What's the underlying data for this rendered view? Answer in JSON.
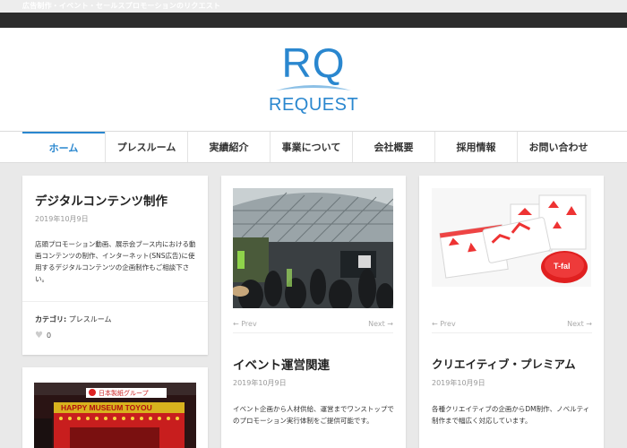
{
  "site": {
    "tagline": "広告制作・イベント・セールスプロモーションのリクエスト",
    "logo_mark": "RQ",
    "logo_text": "REQUEST"
  },
  "nav": {
    "items": [
      {
        "label": "ホーム",
        "active": true
      },
      {
        "label": "プレスルーム",
        "active": false
      },
      {
        "label": "実績紹介",
        "active": false
      },
      {
        "label": "事業について",
        "active": false
      },
      {
        "label": "会社概要",
        "active": false
      },
      {
        "label": "採用情報",
        "active": false
      },
      {
        "label": "お問い合わせ",
        "active": false
      }
    ]
  },
  "posts": [
    {
      "title": "デジタルコンテンツ制作",
      "date": "2019年10月9日",
      "excerpt": "店頭プロモーション動画、展示会ブース内における動画コンテンツの制作、インターネット(SNS広告)に使用するデジタルコンテンツの企画制作もご相談下さい。",
      "category_label": "カテゴリ:",
      "category": "プレスルーム",
      "likes": "0"
    },
    {
      "title": "イベント運営関連",
      "date": "2019年10月9日",
      "excerpt": "イベント企画から人材供給、運営までワンストップでのプロモーション実行体制をご提供可能です。",
      "prev": "← Prev",
      "next": "Next →"
    },
    {
      "title": "クリエイティブ・プレミアム",
      "date": "2019年10月9日",
      "excerpt": "各種クリエイティブの企画からDM制作、ノベルティ制作まで幅広く対応しています。",
      "prev": "← Prev",
      "next": "Next →",
      "brand": "T-fal"
    },
    {
      "booth_sign": "HAPPY MUSEUM TOYOU",
      "banner": "日本製紙グループ"
    }
  ],
  "colors": {
    "accent": "#2a87cf",
    "dark_bar": "#2c2c2c",
    "page_bg": "#e9e9e9"
  }
}
